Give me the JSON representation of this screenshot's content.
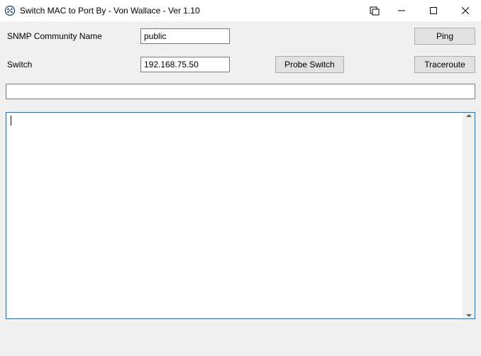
{
  "window": {
    "title": "Switch MAC to Port By - Von Wallace - Ver 1.10"
  },
  "form": {
    "snmp_label": "SNMP Community Name",
    "snmp_value": "public",
    "switch_label": "Switch",
    "switch_value": "192.168.75.50"
  },
  "buttons": {
    "ping": "Ping",
    "probe": "Probe Switch",
    "traceroute": "Traceroute"
  },
  "status": {
    "line": ""
  },
  "output": {
    "text": ""
  }
}
